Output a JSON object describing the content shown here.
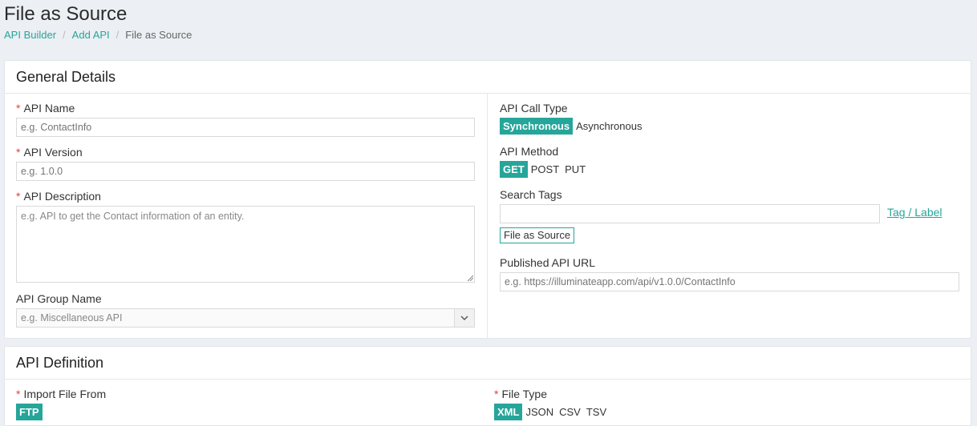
{
  "page": {
    "title": "File as Source",
    "breadcrumb": [
      "API Builder",
      "Add API",
      "File as Source"
    ]
  },
  "general": {
    "heading": "General Details",
    "api_name": {
      "label": "API Name",
      "placeholder": "e.g. ContactInfo"
    },
    "api_version": {
      "label": "API Version",
      "placeholder": "e.g. 1.0.0"
    },
    "api_description": {
      "label": "API Description",
      "placeholder": "e.g. API to get the Contact information of an entity."
    },
    "api_group": {
      "label": "API Group Name",
      "selected": "e.g. Miscellaneous API"
    },
    "call_type": {
      "label": "API Call Type",
      "options": [
        "Synchronous",
        "Asynchronous"
      ],
      "selected": "Synchronous"
    },
    "method": {
      "label": "API Method",
      "options": [
        "GET",
        "POST",
        "PUT"
      ],
      "selected": "GET"
    },
    "tags": {
      "label": "Search Tags",
      "link": "Tag / Label",
      "chip": "File as Source"
    },
    "url": {
      "label": "Published API URL",
      "placeholder": "e.g. https://illuminateapp.com/api/v1.0.0/ContactInfo"
    }
  },
  "definition": {
    "heading": "API Definition",
    "import_from": {
      "label": "Import File From",
      "options": [
        "FTP"
      ],
      "selected": "FTP"
    },
    "file_type": {
      "label": "File Type",
      "options": [
        "XML",
        "JSON",
        "CSV",
        "TSV"
      ],
      "selected": "XML"
    }
  },
  "colors": {
    "accent": "#26a59a",
    "required": "#e0443a",
    "background": "#eceff3"
  }
}
